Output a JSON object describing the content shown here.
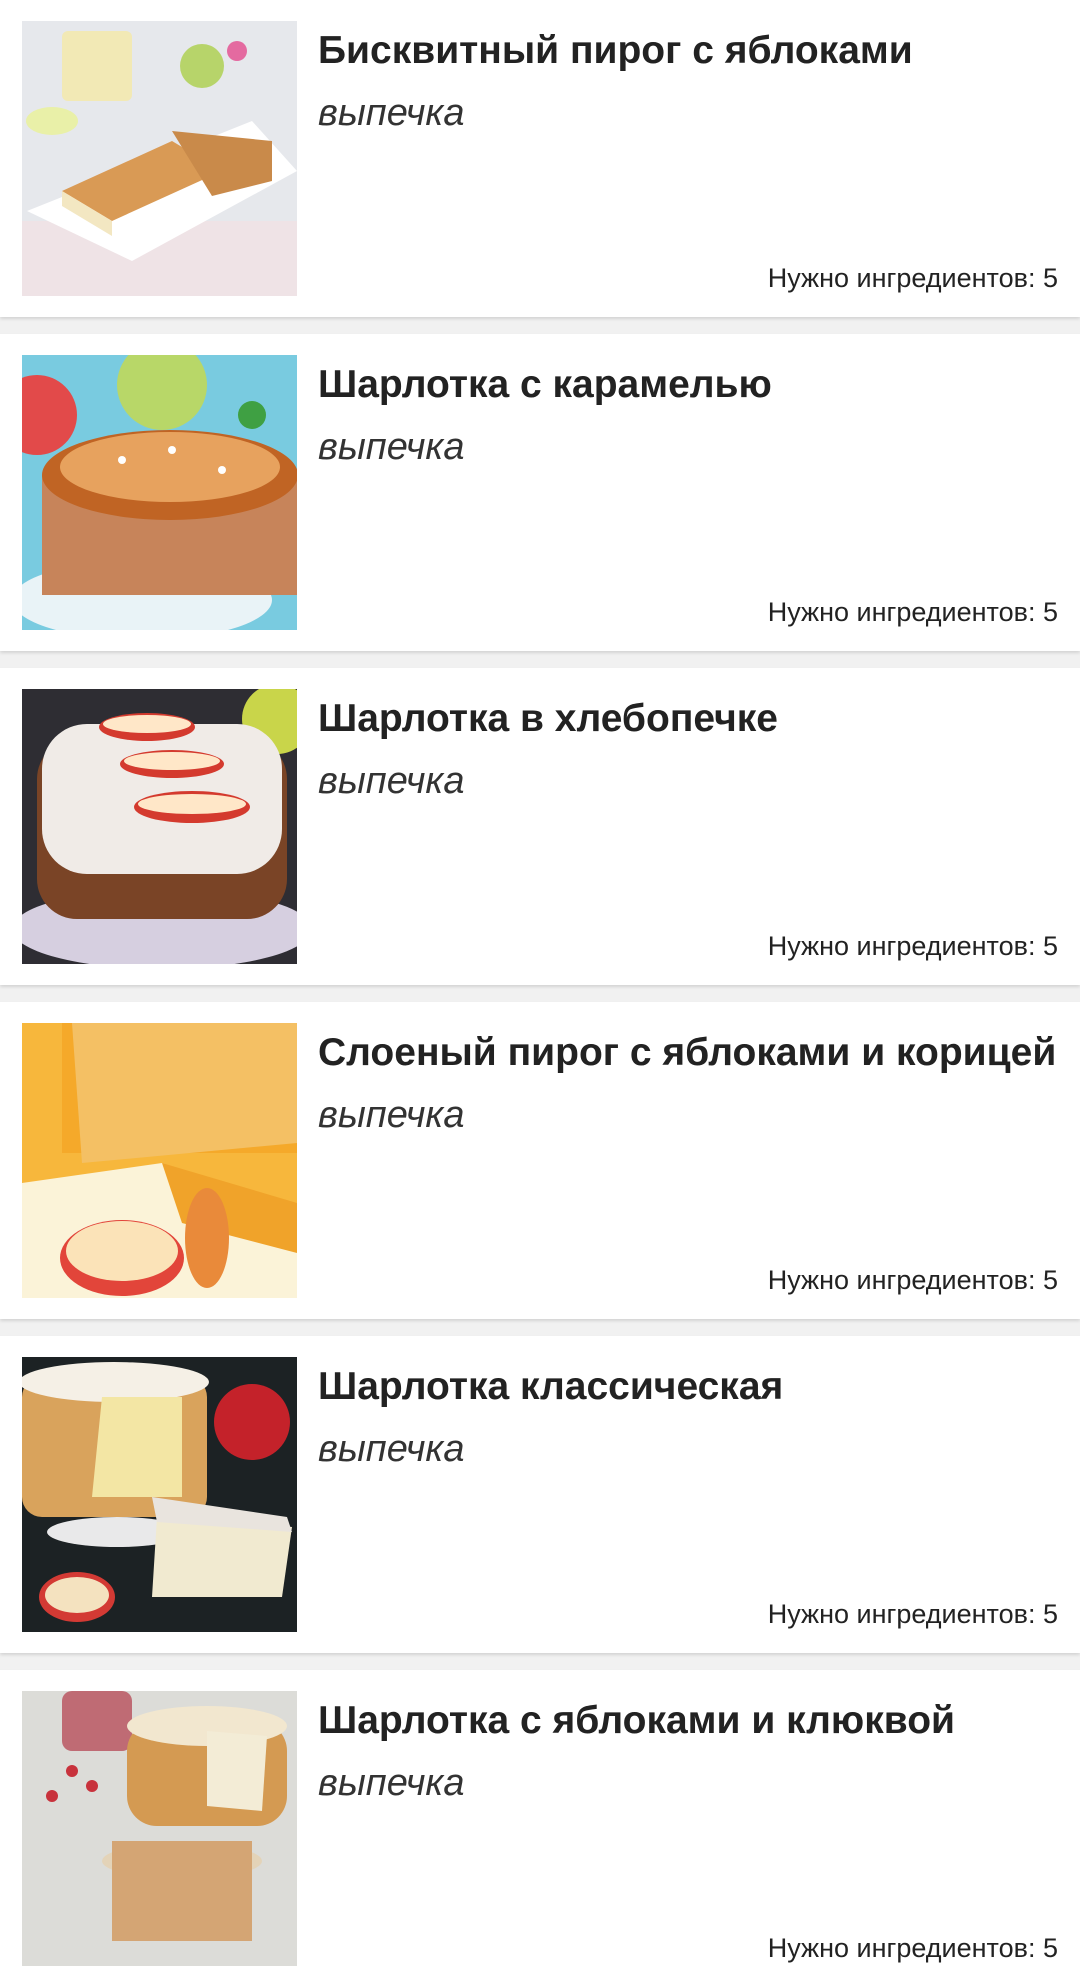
{
  "recipes": [
    {
      "title": "Бисквитный пирог с яблоками",
      "category": "выпечка",
      "ingredients_label": "Нужно ингредиентов: 5",
      "image_icon": "sponge-apple-pie-photo",
      "colors": {
        "bg": "#e9ecf0",
        "accent": "#c98a4a",
        "light": "#f6efd9"
      }
    },
    {
      "title": "Шарлотка с карамелью",
      "category": "выпечка",
      "ingredients_label": "Нужно ингредиентов: 5",
      "image_icon": "caramel-charlotte-photo",
      "colors": {
        "bg": "#7fd0e6",
        "accent": "#b8612a",
        "light": "#e6a35c"
      }
    },
    {
      "title": "Шарлотка в хлебопечке",
      "category": "выпечка",
      "ingredients_label": "Нужно ингредиентов: 5",
      "image_icon": "breadmaker-charlotte-photo",
      "colors": {
        "bg": "#3a3a3a",
        "accent": "#a66a3a",
        "light": "#efe8e2"
      }
    },
    {
      "title": "Слоеный пирог с яблоками и корицей",
      "category": "выпечка",
      "ingredients_label": "Нужно ингредиентов: 5",
      "image_icon": "puff-pastry-pie-photo",
      "colors": {
        "bg": "#f4b23a",
        "accent": "#e08a1c",
        "light": "#f8e8b0"
      }
    },
    {
      "title": "Шарлотка классическая",
      "category": "выпечка",
      "ingredients_label": "Нужно ингредиентов: 5",
      "image_icon": "classic-charlotte-photo",
      "colors": {
        "bg": "#1e2426",
        "accent": "#d7b56e",
        "light": "#f3ecd8"
      }
    },
    {
      "title": "Шарлотка с яблоками и клюквой",
      "category": "выпечка",
      "ingredients_label": "Нужно ингредиентов: 5",
      "image_icon": "cranberry-charlotte-photo",
      "colors": {
        "bg": "#d9d9d6",
        "accent": "#d49a52",
        "light": "#f2e7cf"
      }
    }
  ]
}
